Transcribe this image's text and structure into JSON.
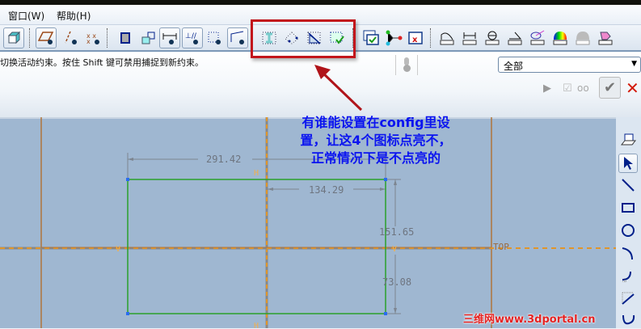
{
  "menu": {
    "window": "窗口(W)",
    "help": "帮助(H)"
  },
  "status": {
    "message": "切换活动约束。按住 Shift 键可禁用捕捉到新约束。"
  },
  "filter": {
    "selected": "全部"
  },
  "annotation": {
    "line1": "有谁能设置在config里设",
    "line2": "置，让这4个图标点亮不，",
    "line3": "正常情况下是不点亮的"
  },
  "sketch": {
    "dim_width": "291.42",
    "dim_right": "134.29",
    "dim_upper": "151.65",
    "dim_lower": "73.08",
    "ref_top": "TOP",
    "h_label": "H",
    "v_label": "V"
  },
  "watermark": "三维网www.3dportal.cn",
  "colors": {
    "canvas": "#9fb7d1",
    "sketch": "#2aa02a",
    "annotation": "#0b14f0",
    "highlight": "#c2151b"
  }
}
